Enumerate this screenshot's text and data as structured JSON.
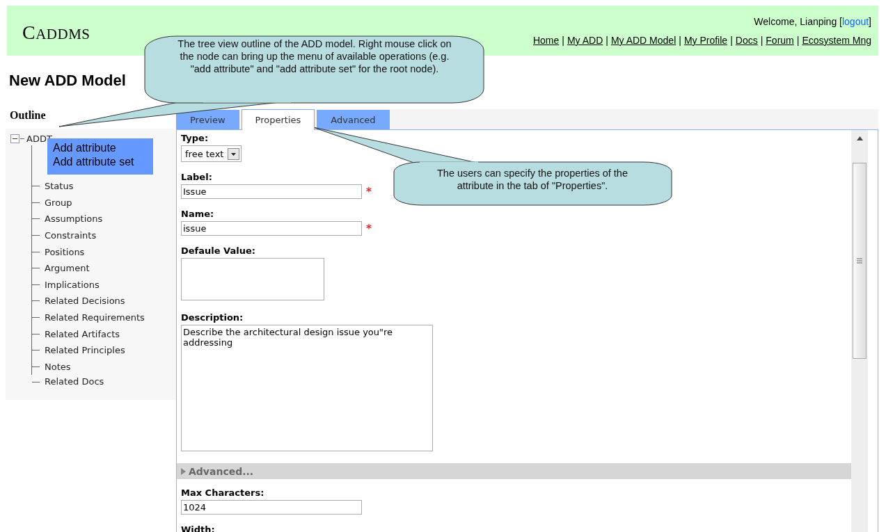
{
  "header": {
    "logo": "CADDMS",
    "welcome": "Welcome, Lianping [",
    "logout": "logout",
    "welcome_end": "]",
    "separator": "|",
    "nav": [
      "Home",
      "My ADD",
      "My ADD Model",
      "My Profile",
      "Docs",
      "Forum",
      "Ecosystem Mng"
    ]
  },
  "page_title": "New ADD Model",
  "outline": {
    "title": "Outline",
    "tree": {
      "label": "ADDT",
      "expanded": true,
      "children": [
        {
          "label": "Status"
        },
        {
          "label": "Group"
        },
        {
          "label": "Assumptions"
        },
        {
          "label": "Constraints"
        },
        {
          "label": "Positions"
        },
        {
          "label": "Argument"
        },
        {
          "label": "Implications"
        },
        {
          "label": "Related Decisions"
        },
        {
          "label": "Related Requirements"
        },
        {
          "label": "Related Artifacts"
        },
        {
          "label": "Related Principles"
        },
        {
          "label": "Notes"
        },
        {
          "label": "Related Docs"
        }
      ]
    }
  },
  "context_menu": [
    "Add attribute",
    "Add attribute set"
  ],
  "tabs": [
    {
      "label": "Preview",
      "selected": false
    },
    {
      "label": "Properties",
      "selected": true
    },
    {
      "label": "Advanced",
      "selected": false
    }
  ],
  "fields": [
    {
      "kind": "select",
      "label": "Type:",
      "value": "free text"
    },
    {
      "kind": "text",
      "label": "Label:",
      "value": "Issue",
      "required": true
    },
    {
      "kind": "text",
      "label": "Name:",
      "value": "issue",
      "required": true
    },
    {
      "kind": "area",
      "label": "Defaule Value:"
    },
    {
      "kind": "bigarea",
      "label": "Description:",
      "value": "Describe the architectural design issue you\"re addressing"
    },
    {
      "kind": "section",
      "label": "Advanced...",
      "expanded": false
    },
    {
      "kind": "text",
      "label": "Max Characters:",
      "value": "1024",
      "required": false
    },
    {
      "kind": "label",
      "label": "Width:"
    }
  ],
  "required_mark": "*",
  "callouts": [
    "The tree view outline of the ADD model. Right mouse click on the node can bring up the menu of available operations (e.g. \"add attribute\" and \"add attribute set\" for the root node).",
    "The users can specify the properties of the attribute in the tab of \"Properties\"."
  ]
}
